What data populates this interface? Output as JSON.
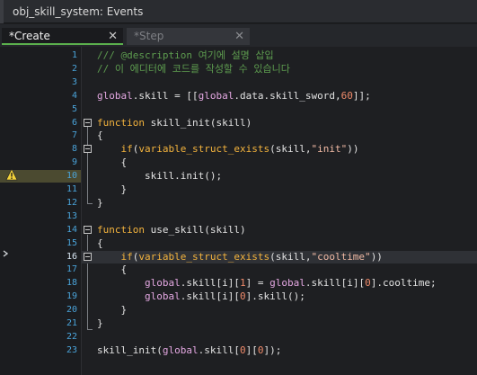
{
  "window": {
    "title": "obj_skill_system: Events"
  },
  "tabs": [
    {
      "label": "*Create",
      "close": "✕"
    },
    {
      "label": "*Step",
      "close": "✕"
    }
  ],
  "lines": [
    {
      "n": "1",
      "text": "/// @description 여기에 설명 삽입"
    },
    {
      "n": "2",
      "text": "// 이 에디터에 코드를 작성할 수 있습니다"
    },
    {
      "n": "3",
      "text": ""
    },
    {
      "n": "4",
      "text": "global.skill = [[global.data.skill_sword,60]];"
    },
    {
      "n": "5",
      "text": ""
    },
    {
      "n": "6",
      "text": "function skill_init(skill)"
    },
    {
      "n": "7",
      "text": "{"
    },
    {
      "n": "8",
      "text": "    if(variable_struct_exists(skill,\"init\"))"
    },
    {
      "n": "9",
      "text": "    {"
    },
    {
      "n": "10",
      "text": "        skill.init();"
    },
    {
      "n": "11",
      "text": "    }"
    },
    {
      "n": "12",
      "text": "}"
    },
    {
      "n": "13",
      "text": ""
    },
    {
      "n": "14",
      "text": "function use_skill(skill)"
    },
    {
      "n": "15",
      "text": "{"
    },
    {
      "n": "16",
      "text": "    if(variable_struct_exists(skill,\"cooltime\"))"
    },
    {
      "n": "17",
      "text": "    {"
    },
    {
      "n": "18",
      "text": "        global.skill[i][1] = global.skill[i][0].cooltime;"
    },
    {
      "n": "19",
      "text": "        global.skill[i][0].skill();"
    },
    {
      "n": "20",
      "text": "    }"
    },
    {
      "n": "21",
      "text": "}"
    },
    {
      "n": "22",
      "text": ""
    },
    {
      "n": "23",
      "text": "skill_init(global.skill[0][0]);"
    }
  ],
  "colors": {
    "comment": "#5d9c4f",
    "keyword": "#f3b33d",
    "variable": "#e3a7e1",
    "string": "#f0b9a4",
    "number": "#ee8a6a",
    "line_number": "#4aa3d9",
    "warning_bg": "#4b4a30"
  },
  "markers": {
    "warning_line": "10",
    "current_line": "16"
  }
}
